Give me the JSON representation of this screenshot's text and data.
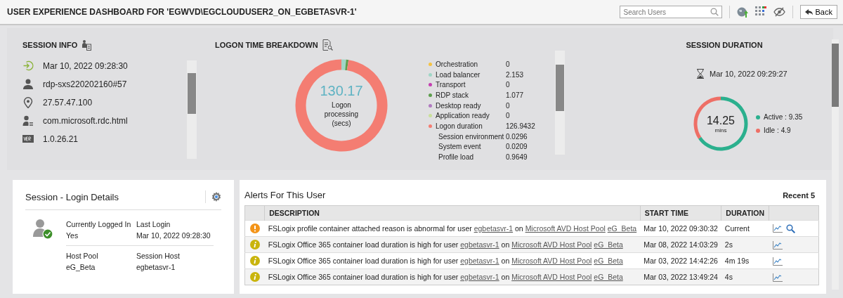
{
  "header": {
    "title": "USER EXPERIENCE DASHBOARD FOR 'EGWVD\\EGCLOUDUSER2_ON_EGBETASVR-1'",
    "search": {
      "placeholder": "Search Users"
    },
    "back": "Back"
  },
  "session_info": {
    "title": "SESSION INFO",
    "items": [
      {
        "kind": "login",
        "text": "Mar 10, 2022 09:28:30"
      },
      {
        "kind": "user",
        "text": "rdp-sxs220202160#57"
      },
      {
        "kind": "location",
        "text": "27.57.47.100"
      },
      {
        "kind": "client",
        "text": "com.microsoft.rdc.html"
      },
      {
        "kind": "version",
        "text": "1.0.26.21"
      }
    ]
  },
  "logon": {
    "title": "LOGON TIME BREAKDOWN",
    "total": "130.17",
    "caption": "Logon processing (secs)",
    "items": [
      {
        "label": "Orchestration",
        "value": "0",
        "color": "#f5c342"
      },
      {
        "label": "Load balancer",
        "value": "2.153",
        "color": "#9fd6c6"
      },
      {
        "label": "Transport",
        "value": "0",
        "color": "#c43fb0"
      },
      {
        "label": "RDP stack",
        "value": "1.077",
        "color": "#5c9e4c"
      },
      {
        "label": "Desktop ready",
        "value": "0",
        "color": "#b07ac0"
      },
      {
        "label": "Application ready",
        "value": "0",
        "color": "#c9e09a"
      },
      {
        "label": "Logon duration",
        "value": "126.9432",
        "color": "#f47d72",
        "children": [
          {
            "label": "Session environment",
            "value": "0.0296"
          },
          {
            "label": "System event",
            "value": "0.0209"
          },
          {
            "label": "Profile load",
            "value": "0.9649"
          }
        ]
      }
    ]
  },
  "duration": {
    "title": "SESSION DURATION",
    "time": "Mar 10, 2022 09:29:27",
    "total": "14.25",
    "unit": "mins",
    "items": [
      {
        "label": "Active :",
        "value": "9.35",
        "color": "#2bb08e"
      },
      {
        "label": "Idle :",
        "value": "4.9",
        "color": "#ee6f66"
      }
    ]
  },
  "login_details": {
    "title": "Session - Login Details",
    "fields": [
      {
        "label": "Currently Logged In",
        "value": "Yes"
      },
      {
        "label": "Last Login",
        "value": "Mar 10, 2022 09:28:30"
      },
      {
        "label": "Host Pool",
        "value": "eG_Beta"
      },
      {
        "label": "Session Host",
        "value": "egbetasvr-1"
      }
    ]
  },
  "alerts": {
    "title": "Alerts For This User",
    "recent": "Recent 5",
    "columns": [
      "DESCRIPTION",
      "START TIME",
      "DURATION"
    ],
    "rows": [
      {
        "kind": "major",
        "parts": [
          {
            "kind": "text",
            "text": "FSLogix profile container attached reason is abnormal for user"
          },
          {
            "kind": "link",
            "text": "egbetasvr-1"
          },
          {
            "kind": "text",
            "text": "on"
          },
          {
            "kind": "link",
            "text": "Microsoft AVD Host Pool"
          },
          {
            "kind": "link",
            "text": "eG_Beta"
          }
        ],
        "start": "Mar 10, 2022 09:30:32",
        "duration": "Current",
        "search": true
      },
      {
        "kind": "minor",
        "parts": [
          {
            "kind": "text",
            "text": "FSLogix Office 365 container load duration is high for user"
          },
          {
            "kind": "link",
            "text": "egbetasvr-1"
          },
          {
            "kind": "text",
            "text": "on"
          },
          {
            "kind": "link",
            "text": "Microsoft AVD Host Pool"
          },
          {
            "kind": "link",
            "text": "eG_Beta"
          }
        ],
        "start": "Mar 08, 2022 14:03:29",
        "duration": "2s",
        "search": false
      },
      {
        "kind": "minor",
        "parts": [
          {
            "kind": "text",
            "text": "FSLogix Office 365 container load duration is high for user"
          },
          {
            "kind": "link",
            "text": "egbetasvr-1"
          },
          {
            "kind": "text",
            "text": "on"
          },
          {
            "kind": "link",
            "text": "Microsoft AVD Host Pool"
          },
          {
            "kind": "link",
            "text": "eG_Beta"
          }
        ],
        "start": "Mar 03, 2022 14:42:26",
        "duration": "4m 19s",
        "search": false
      },
      {
        "kind": "minor",
        "parts": [
          {
            "kind": "text",
            "text": "FSLogix Office 365 container load duration is high for user"
          },
          {
            "kind": "link",
            "text": "egbetasvr-1"
          },
          {
            "kind": "text",
            "text": "on"
          },
          {
            "kind": "link",
            "text": "Microsoft AVD Host Pool"
          },
          {
            "kind": "link",
            "text": "eG_Beta"
          }
        ],
        "start": "Mar 03, 2022 13:49:24",
        "duration": "4s",
        "search": false
      }
    ]
  }
}
